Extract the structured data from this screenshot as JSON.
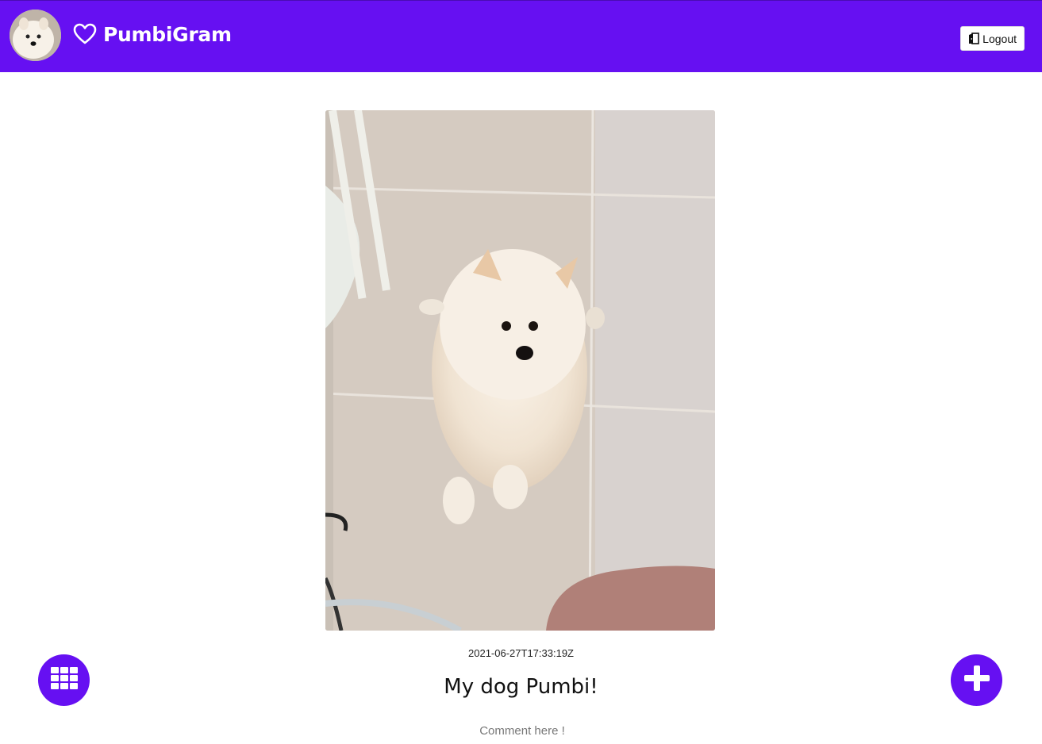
{
  "header": {
    "brand": "PumbiGram",
    "logout_label": "Logout",
    "avatar_icon": "dog-avatar",
    "brand_icon": "heart-icon",
    "logout_icon": "door-exit-icon",
    "background_color": "#6610f2"
  },
  "post": {
    "timestamp": "2021-06-27T17:33:19Z",
    "caption": "My dog Pumbi!",
    "comment_placeholder": "Comment here !",
    "photo_subject": "pomeranian-puppy-photo"
  },
  "actions": {
    "left_icon": "grid-icon",
    "right_icon": "plus-icon"
  }
}
